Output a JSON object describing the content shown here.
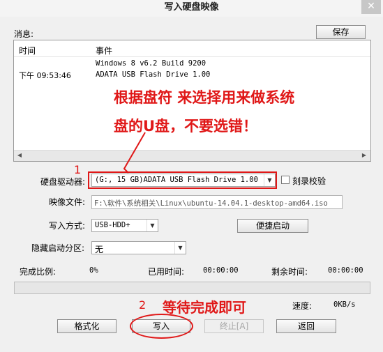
{
  "window": {
    "title": "写入硬盘映像",
    "close": "✕"
  },
  "messages": {
    "label": "消息:",
    "save_label": "保存",
    "col_time": "时间",
    "col_event": "事件",
    "rows": [
      {
        "time": "",
        "event": "Windows 8 v6.2 Build 9200"
      },
      {
        "time": "下午 09:53:46",
        "event": "ADATA   USB Flash Drive 1.00"
      }
    ]
  },
  "annotations": {
    "note_main_line1": "根据盘符 来选择用来做系统",
    "note_main_line2": "盘的U盘，不要选错！",
    "marker_1": "1",
    "marker_2": "2",
    "note_wait": "等待完成即可"
  },
  "form": {
    "drive_label": "硬盘驱动器:",
    "drive_value": "(G:, 15 GB)ADATA   USB Flash Drive 1.00",
    "verify_label": "刻录校验",
    "image_label": "映像文件:",
    "image_value": "F:\\软件\\系统相关\\Linux\\ubuntu-14.04.1-desktop-amd64.iso",
    "method_label": "写入方式:",
    "method_value": "USB-HDD+",
    "quick_boot_label": "便捷启动",
    "hidden_label": "隐藏启动分区:",
    "hidden_value": "无"
  },
  "progress": {
    "ratio_label": "完成比例:",
    "ratio_value": "0%",
    "elapsed_label": "已用时间:",
    "elapsed_value": "00:00:00",
    "remaining_label": "剩余时间:",
    "remaining_value": "00:00:00",
    "fraction": 0,
    "speed_label": "速度:",
    "speed_value": "0KB/s"
  },
  "actions": {
    "format_label": "格式化",
    "write_label": "写入",
    "stop_label": "终止[A]",
    "back_label": "返回"
  },
  "colors": {
    "annotation": "#e01818",
    "accent_border": "#e01818"
  }
}
